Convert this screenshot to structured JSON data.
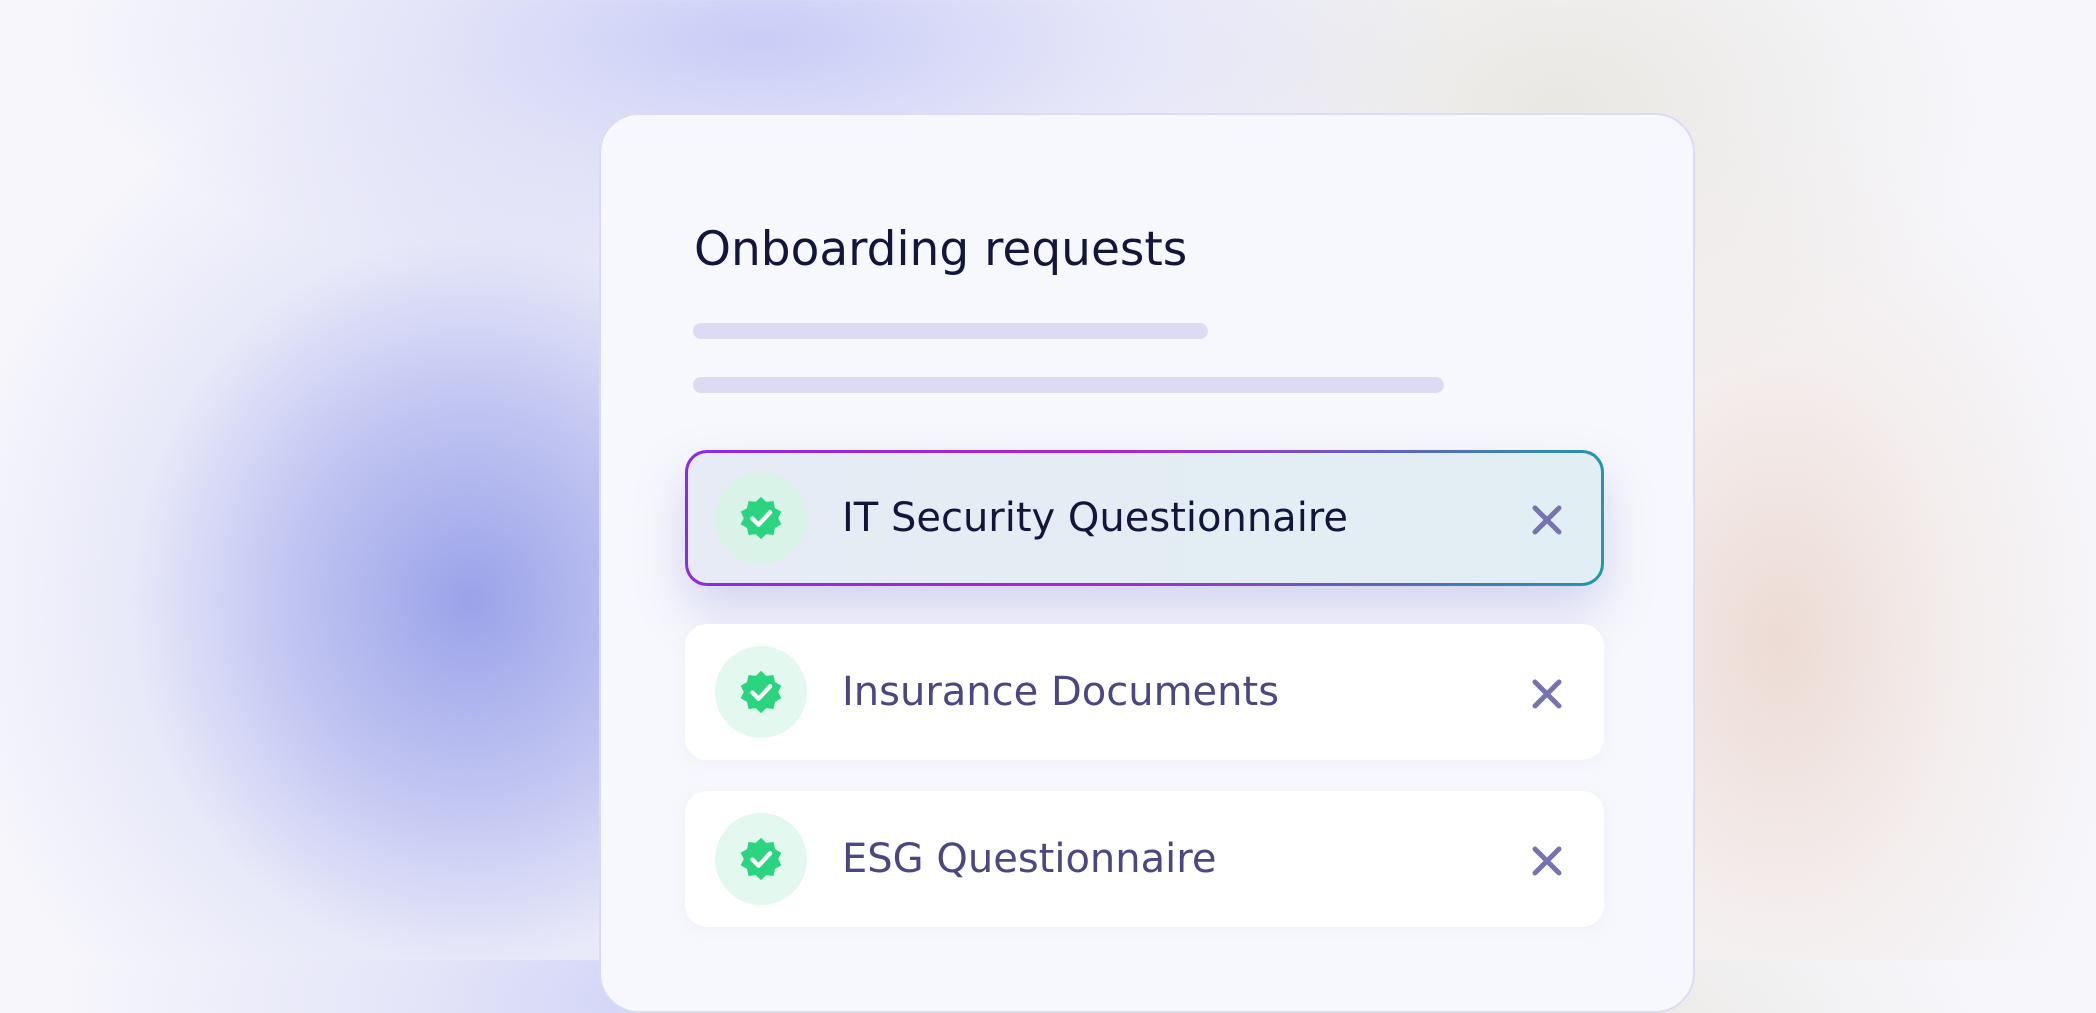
{
  "card": {
    "title": "Onboarding requests"
  },
  "requests": [
    {
      "label": "IT Security Questionnaire",
      "status_icon": "verified-check-badge-icon",
      "selected": true
    },
    {
      "label": "Insurance Documents",
      "status_icon": "verified-check-badge-icon",
      "selected": false
    },
    {
      "label": "ESG Questionnaire",
      "status_icon": "verified-check-badge-icon",
      "selected": false
    }
  ],
  "colors": {
    "accent_green": "#2bd47e",
    "close_icon": "#7673b0",
    "title_text": "#14153a",
    "row_text": "#4b4783",
    "skeleton": "#dddaf3"
  }
}
